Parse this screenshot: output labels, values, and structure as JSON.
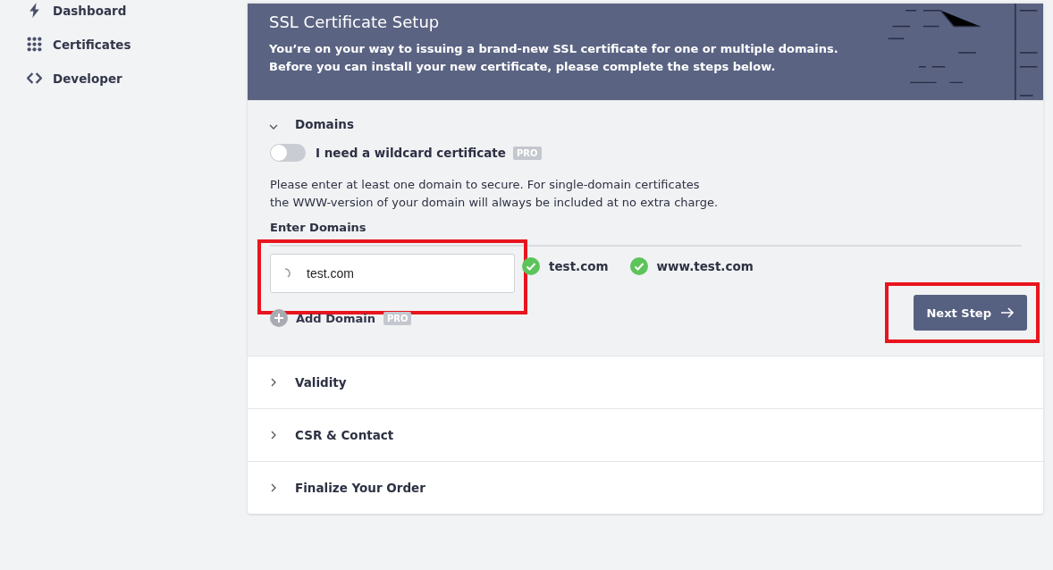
{
  "sidebar": {
    "items": [
      {
        "label": "Dashboard",
        "selected": false
      },
      {
        "label": "Certificates",
        "selected": false
      },
      {
        "label": "Developer",
        "selected": false
      }
    ]
  },
  "header": {
    "title": "SSL Certificate Setup",
    "lines": [
      "You’re on your way to issuing a brand-new SSL certificate for one or multiple domains.",
      "Before you can install your new certificate, please complete the steps below."
    ]
  },
  "steps": [
    {
      "title": "Domains",
      "expanded": true
    },
    {
      "title": "Validity",
      "expanded": false
    },
    {
      "title": "CSR & Contact",
      "expanded": false
    },
    {
      "title": "Finalize Your Order",
      "expanded": false
    }
  ],
  "domains": {
    "wildcard": {
      "label": "I need a wildcard certificate",
      "on": false,
      "badge": "PRO"
    },
    "help": [
      "Please enter at least one domain to secure. For single-domain certificates",
      "the WWW-version of your domain will always be included at no extra charge."
    ],
    "section_label": "Enter Domains",
    "input": {
      "value": "test.com",
      "loading": true,
      "highlighted": true
    },
    "validated": [
      {
        "domain": "test.com",
        "valid": true
      },
      {
        "domain": "www.test.com",
        "valid": true
      }
    ],
    "add": {
      "label": "Add Domain",
      "badge": "PRO"
    },
    "next": {
      "label": "Next Step",
      "highlighted": true
    }
  }
}
